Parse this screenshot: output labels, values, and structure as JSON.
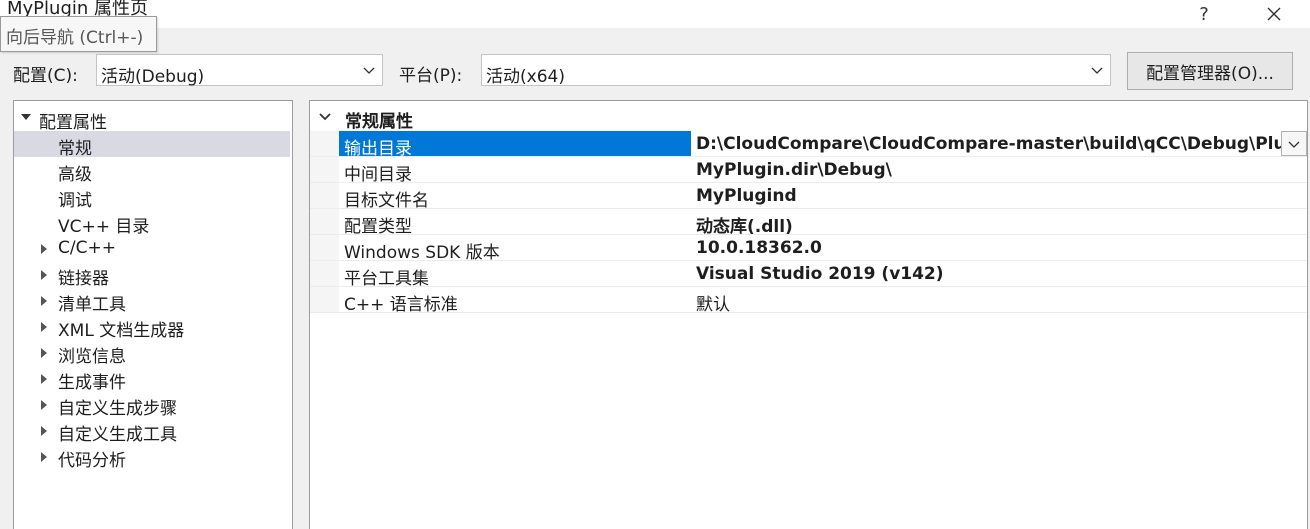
{
  "window": {
    "title": "MyPlugin 属性页",
    "help_label": "?",
    "close_label": "✕"
  },
  "tooltip": {
    "text": "向后导航 (Ctrl+-)"
  },
  "config_bar": {
    "config_label": "配置(C):",
    "config_value": "活动(Debug)",
    "platform_label": "平台(P):",
    "platform_value": "活动(x64)",
    "manager_button": "配置管理器(O)..."
  },
  "tree": {
    "root": "配置属性",
    "items": [
      {
        "label": "常规",
        "expandable": false,
        "selected": true
      },
      {
        "label": "高级",
        "expandable": false
      },
      {
        "label": "调试",
        "expandable": false
      },
      {
        "label": "VC++ 目录",
        "expandable": false
      },
      {
        "label": "C/C++",
        "expandable": true
      },
      {
        "label": "链接器",
        "expandable": true
      },
      {
        "label": "清单工具",
        "expandable": true
      },
      {
        "label": "XML 文档生成器",
        "expandable": true
      },
      {
        "label": "浏览信息",
        "expandable": true
      },
      {
        "label": "生成事件",
        "expandable": true
      },
      {
        "label": "自定义生成步骤",
        "expandable": true
      },
      {
        "label": "自定义生成工具",
        "expandable": true
      },
      {
        "label": "代码分析",
        "expandable": true
      }
    ]
  },
  "grid": {
    "group_title": "常规属性",
    "properties": [
      {
        "name": "输出目录",
        "value": "D:\\CloudCompare\\CloudCompare-master\\build\\qCC\\Debug\\Plu",
        "bold": true,
        "selected": true
      },
      {
        "name": "中间目录",
        "value": "MyPlugin.dir\\Debug\\",
        "bold": true
      },
      {
        "name": "目标文件名",
        "value": "MyPlugind",
        "bold": true
      },
      {
        "name": "配置类型",
        "value": "动态库(.dll)",
        "bold": true
      },
      {
        "name": "Windows SDK 版本",
        "value": "10.0.18362.0",
        "bold": true
      },
      {
        "name": "平台工具集",
        "value": "Visual Studio 2019 (v142)",
        "bold": true
      },
      {
        "name": "C++ 语言标准",
        "value": "默认",
        "bold": false
      }
    ]
  },
  "colors": {
    "selection_blue": "#0078d7",
    "tree_selection": "#d9d9e3"
  }
}
